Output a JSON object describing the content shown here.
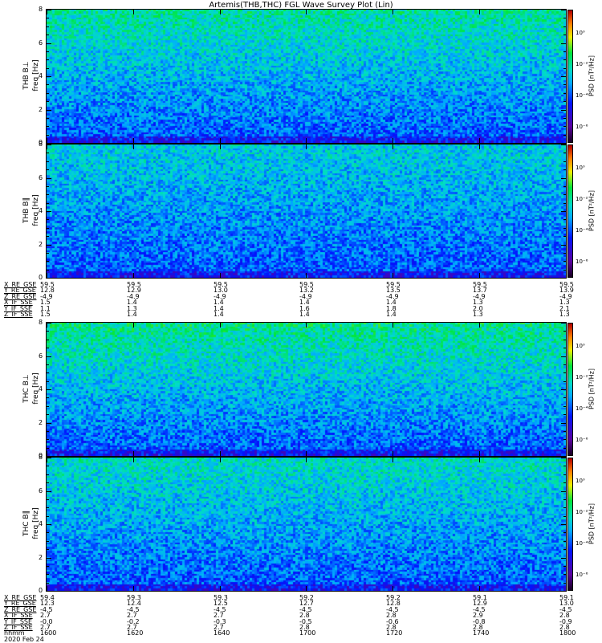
{
  "title": "Artemis(THB,THC) FGL Wave Survey Plot (Lin)",
  "chart_data": {
    "type": "heatmap",
    "title": "Artemis(THB,THC) FGL Wave Survey Plot (Lin)",
    "date": "2020 Feb 24",
    "colorbar": {
      "label": "PSD [nT²/Hz]",
      "scale": "log",
      "ticks": [
        "10⁰",
        "10⁻²",
        "10⁻⁴",
        "10⁻⁶"
      ],
      "tick_values": [
        0,
        -2,
        -4,
        -6
      ],
      "range": [
        -7,
        1.5
      ]
    },
    "yticks": [
      "0",
      "2",
      "4",
      "6",
      "8"
    ],
    "ylim": [
      0,
      8
    ],
    "groups": [
      {
        "panels": [
          {
            "name": "THB B⊥",
            "ylabel": "freq [Hz]",
            "level": 0.75
          },
          {
            "name": "THB B∥",
            "ylabel": "freq [Hz]",
            "level": 0.35
          }
        ],
        "ephemeris": [
          {
            "label": "X_RE_GSE",
            "values": [
              "59.5",
              "59.5",
              "59.5",
              "59.5",
              "59.5",
              "59.5",
              "59.5"
            ]
          },
          {
            "label": "Y_RE_GSE",
            "values": [
              "12.8",
              "12.9",
              "13.0",
              "13.2",
              "13.5",
              "13.7",
              "13.9"
            ]
          },
          {
            "label": "Z_RE_GSE",
            "values": [
              "-4.9",
              "-4.9",
              "-4.9",
              "-4.9",
              "-4.9",
              "-4.9",
              "-4.9"
            ]
          },
          {
            "label": "X_IF_SSE",
            "values": [
              "1.5",
              "1.4",
              "1.4",
              "1.4",
              "1.4",
              "1.3",
              "1.3"
            ]
          },
          {
            "label": "Y_IF_SSE",
            "values": [
              "1.1",
              "1.3",
              "1.4",
              "1.6",
              "1.8",
              "2.0",
              "2.1"
            ]
          },
          {
            "label": "Z_IF_SSE",
            "values": [
              "1.5",
              "1.4",
              "1.4",
              "1.4",
              "1.4",
              "1.3",
              "1.3"
            ]
          }
        ]
      },
      {
        "panels": [
          {
            "name": "THC B⊥",
            "ylabel": "freq [Hz]",
            "level": 0.85
          },
          {
            "name": "THC B∥",
            "ylabel": "freq [Hz]",
            "level": 0.55
          }
        ],
        "ephemeris": [
          {
            "label": "X_RE_GSE",
            "values": [
              "59.4",
              "59.3",
              "59.3",
              "59.2",
              "59.2",
              "59.1",
              "59.1"
            ]
          },
          {
            "label": "Y_RE_GSE",
            "values": [
              "12.3",
              "12.4",
              "12.5",
              "12.7",
              "12.8",
              "12.9",
              "13.0"
            ]
          },
          {
            "label": "Z_RE_GSE",
            "values": [
              "-4.5",
              "-4.5",
              "-4.5",
              "-4.5",
              "-4.5",
              "-4.5",
              "-4.5"
            ]
          },
          {
            "label": "X_IF_SSE",
            "values": [
              "2.7",
              "2.7",
              "2.7",
              "2.8",
              "2.8",
              "2.9",
              "2.8"
            ]
          },
          {
            "label": "Y_IF_SSE",
            "values": [
              "-0.0",
              "-0.2",
              "-0.3",
              "-0.5",
              "-0.6",
              "-0.8",
              "-0.9"
            ]
          },
          {
            "label": "Z_IF_SSE",
            "values": [
              "2.7",
              "2.7",
              "2.7",
              "2.8",
              "2.8",
              "2.8",
              "2.8"
            ]
          },
          {
            "label": "hhmm",
            "values": [
              "1600",
              "1620",
              "1640",
              "1700",
              "1720",
              "1740",
              "1800"
            ]
          }
        ]
      }
    ]
  }
}
